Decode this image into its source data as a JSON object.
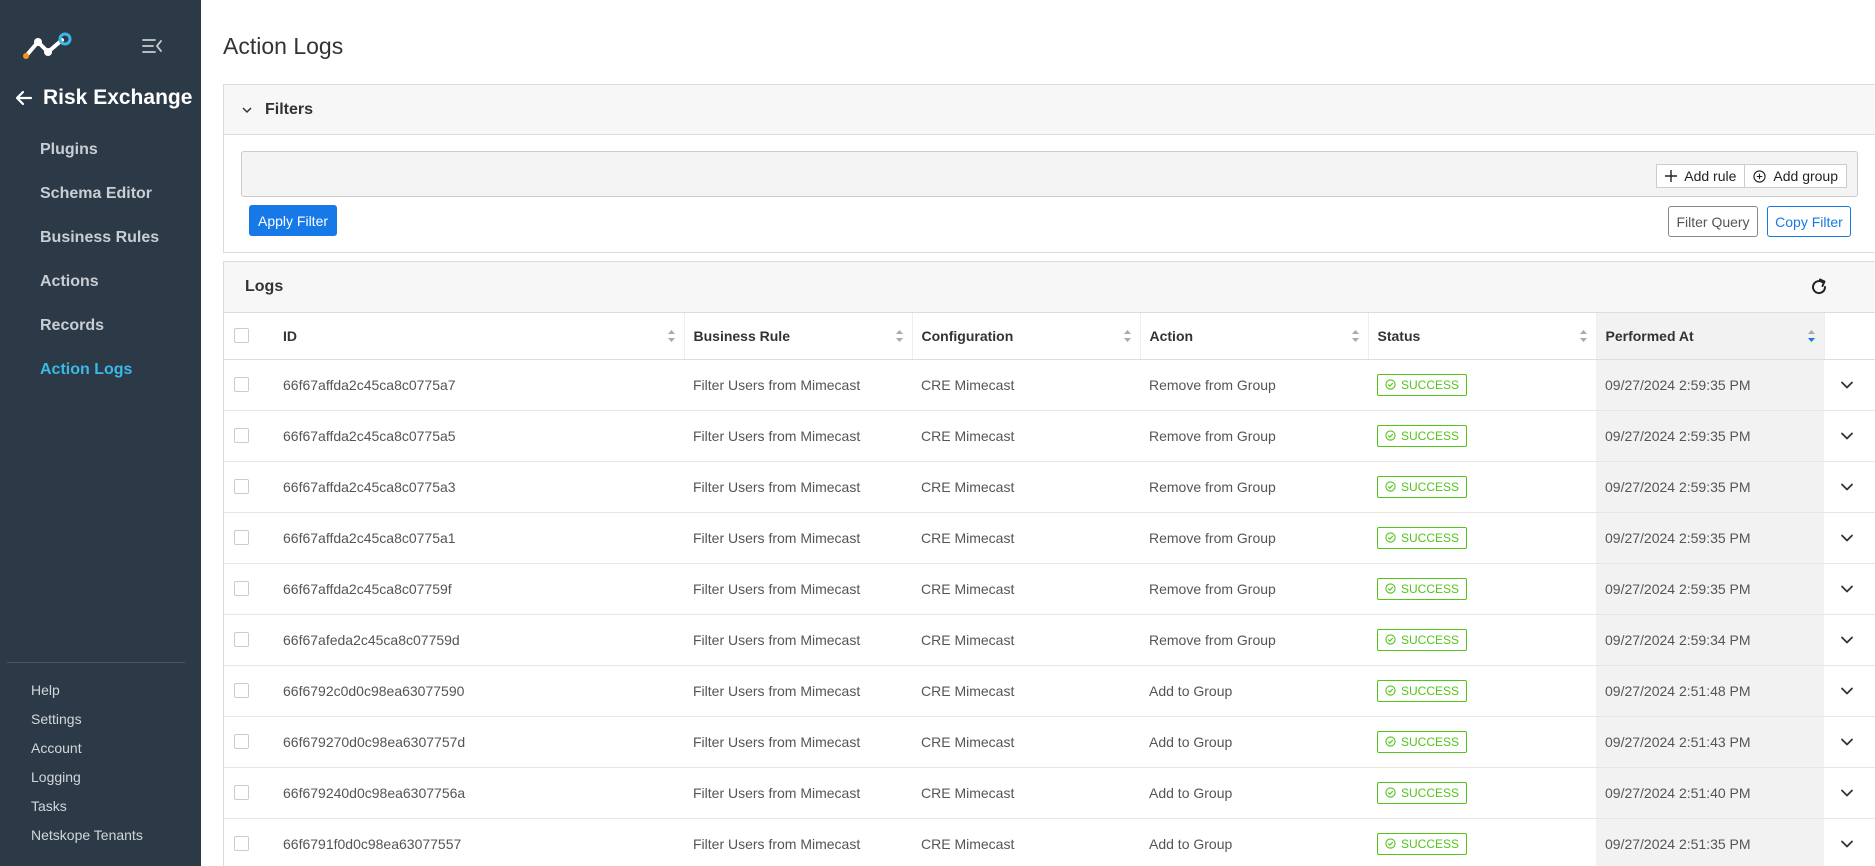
{
  "sidebar": {
    "title": "Risk Exchange",
    "nav": [
      "Plugins",
      "Schema Editor",
      "Business Rules",
      "Actions",
      "Records",
      "Action Logs"
    ],
    "active": "Action Logs",
    "bottom": [
      "Help",
      "Settings",
      "Account",
      "Logging",
      "Tasks",
      "Netskope Tenants"
    ]
  },
  "page": {
    "title": "Action Logs"
  },
  "filters": {
    "title": "Filters",
    "add_rule": "Add rule",
    "add_group": "Add group",
    "apply": "Apply Filter",
    "filter_query": "Filter Query",
    "copy_filter": "Copy Filter"
  },
  "logs": {
    "title": "Logs",
    "columns": [
      "ID",
      "Business Rule",
      "Configuration",
      "Action",
      "Status",
      "Performed At"
    ],
    "rows": [
      {
        "id": "66f67affda2c45ca8c0775a7",
        "rule": "Filter Users from Mimecast",
        "config": "CRE Mimecast",
        "action": "Remove from Group",
        "status": "SUCCESS",
        "at": "09/27/2024 2:59:35 PM"
      },
      {
        "id": "66f67affda2c45ca8c0775a5",
        "rule": "Filter Users from Mimecast",
        "config": "CRE Mimecast",
        "action": "Remove from Group",
        "status": "SUCCESS",
        "at": "09/27/2024 2:59:35 PM"
      },
      {
        "id": "66f67affda2c45ca8c0775a3",
        "rule": "Filter Users from Mimecast",
        "config": "CRE Mimecast",
        "action": "Remove from Group",
        "status": "SUCCESS",
        "at": "09/27/2024 2:59:35 PM"
      },
      {
        "id": "66f67affda2c45ca8c0775a1",
        "rule": "Filter Users from Mimecast",
        "config": "CRE Mimecast",
        "action": "Remove from Group",
        "status": "SUCCESS",
        "at": "09/27/2024 2:59:35 PM"
      },
      {
        "id": "66f67affda2c45ca8c07759f",
        "rule": "Filter Users from Mimecast",
        "config": "CRE Mimecast",
        "action": "Remove from Group",
        "status": "SUCCESS",
        "at": "09/27/2024 2:59:35 PM"
      },
      {
        "id": "66f67afeda2c45ca8c07759d",
        "rule": "Filter Users from Mimecast",
        "config": "CRE Mimecast",
        "action": "Remove from Group",
        "status": "SUCCESS",
        "at": "09/27/2024 2:59:34 PM"
      },
      {
        "id": "66f6792c0d0c98ea63077590",
        "rule": "Filter Users from Mimecast",
        "config": "CRE Mimecast",
        "action": "Add to Group",
        "status": "SUCCESS",
        "at": "09/27/2024 2:51:48 PM"
      },
      {
        "id": "66f679270d0c98ea6307757d",
        "rule": "Filter Users from Mimecast",
        "config": "CRE Mimecast",
        "action": "Add to Group",
        "status": "SUCCESS",
        "at": "09/27/2024 2:51:43 PM"
      },
      {
        "id": "66f679240d0c98ea6307756a",
        "rule": "Filter Users from Mimecast",
        "config": "CRE Mimecast",
        "action": "Add to Group",
        "status": "SUCCESS",
        "at": "09/27/2024 2:51:40 PM"
      },
      {
        "id": "66f6791f0d0c98ea63077557",
        "rule": "Filter Users from Mimecast",
        "config": "CRE Mimecast",
        "action": "Add to Group",
        "status": "SUCCESS",
        "at": "09/27/2024 2:51:35 PM"
      }
    ]
  },
  "icons": {
    "logo": "netskope-logo-icon",
    "menu": "collapse-menu-icon",
    "back": "arrow-left-icon",
    "filters": "chevron-down-icon",
    "add_rule": "plus-icon",
    "add_group": "plus-circle-icon",
    "refresh": "refresh-icon",
    "status": "check-circle-icon",
    "expand": "chevron-down-icon",
    "sort": "sort-icon"
  },
  "colors": {
    "sidebar_bg": "#2c3a47",
    "active_nav": "#3bb8e8",
    "primary": "#1779e8",
    "success": "#52c41a"
  }
}
